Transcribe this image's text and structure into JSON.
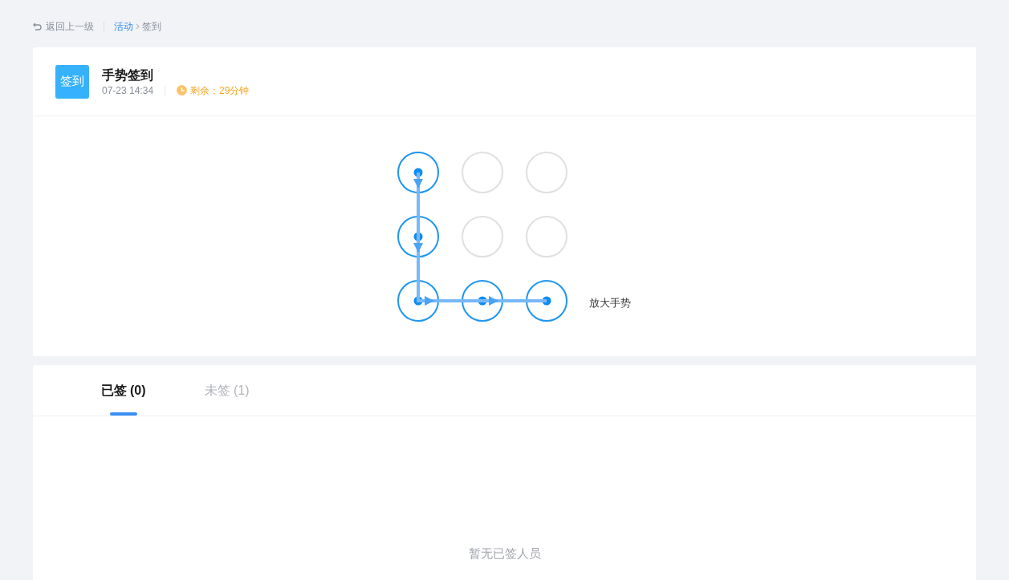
{
  "breadcrumb": {
    "back": "返回上一级",
    "items": [
      {
        "label": "活动",
        "link": true
      },
      {
        "label": "签到",
        "link": false
      }
    ]
  },
  "activity": {
    "badge": "签到",
    "title": "手势签到",
    "time": "07-23 14:34",
    "remaining": "剩余：29分钟"
  },
  "gesture": {
    "nodes": [
      {
        "active": true
      },
      {
        "active": false
      },
      {
        "active": false
      },
      {
        "active": true
      },
      {
        "active": false
      },
      {
        "active": false
      },
      {
        "active": true
      },
      {
        "active": true
      },
      {
        "active": true
      }
    ],
    "zoom_label": "放大手势"
  },
  "tabs": [
    {
      "label": "已签 (0)",
      "selected": true
    },
    {
      "label": "未签 (1)",
      "selected": false
    }
  ],
  "empty_text": "暂无已签人员"
}
